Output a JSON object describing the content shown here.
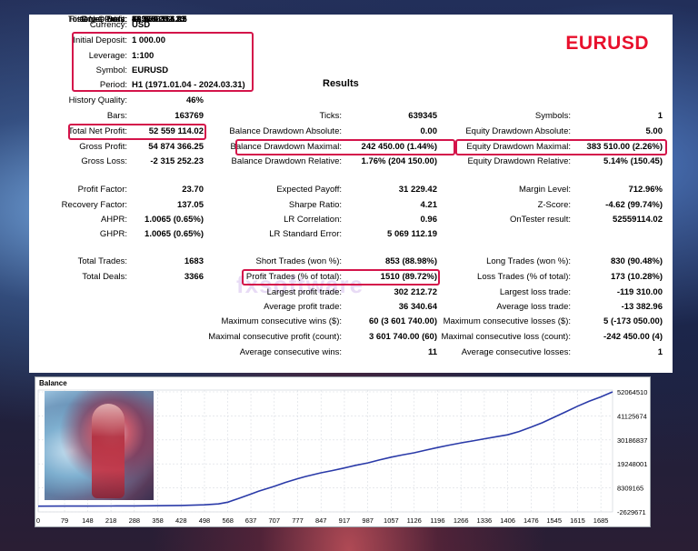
{
  "panel_title": "EURUSD",
  "results_title": "Results",
  "top_left": [
    {
      "label": "Currency:",
      "value": "USD"
    },
    {
      "label": "Initial Deposit:",
      "value": "1 000.00"
    },
    {
      "label": "Leverage:",
      "value": "1:100"
    },
    {
      "label": "Symbol:",
      "value": "EURUSD"
    },
    {
      "label": "Period:",
      "value": "H1 (1971.01.04 - 2024.03.31)"
    },
    {
      "label": "History Quality:",
      "value": "46%"
    },
    {
      "label": "Bars:",
      "value": "163769"
    },
    {
      "label": "Total Net Profit:",
      "value": "52 559 114.02"
    },
    {
      "label": "Gross Profit:",
      "value": "54 874 366.25"
    },
    {
      "label": "Gross Loss:",
      "value": "-2 315 252.23"
    }
  ],
  "mid_top": [
    {
      "label": "Ticks:",
      "value": "639345"
    },
    {
      "label": "Balance Drawdown Absolute:",
      "value": "0.00"
    },
    {
      "label": "Balance Drawdown Maximal:",
      "value": "242 450.00 (1.44%)"
    },
    {
      "label": "Balance Drawdown Relative:",
      "value": "1.76% (204 150.00)"
    }
  ],
  "right_top": [
    {
      "label": "Symbols:",
      "value": "1"
    },
    {
      "label": "Equity Drawdown Absolute:",
      "value": "5.00"
    },
    {
      "label": "Equity Drawdown Maximal:",
      "value": "383 510.00 (2.26%)"
    },
    {
      "label": "Equity Drawdown Relative:",
      "value": "5.14% (150.45)"
    }
  ],
  "left_mid": [
    {
      "label": "Profit Factor:",
      "value": "23.70"
    },
    {
      "label": "Recovery Factor:",
      "value": "137.05"
    },
    {
      "label": "AHPR:",
      "value": "1.0065 (0.65%)"
    },
    {
      "label": "GHPR:",
      "value": "1.0065 (0.65%)"
    }
  ],
  "mid_mid": [
    {
      "label": "Expected Payoff:",
      "value": "31 229.42"
    },
    {
      "label": "Sharpe Ratio:",
      "value": "4.21"
    },
    {
      "label": "LR Correlation:",
      "value": "0.96"
    },
    {
      "label": "LR Standard Error:",
      "value": "5 069 112.19"
    }
  ],
  "right_mid": [
    {
      "label": "Margin Level:",
      "value": "712.96%"
    },
    {
      "label": "Z-Score:",
      "value": "-4.62 (99.74%)"
    },
    {
      "label": "OnTester result:",
      "value": "52559114.02"
    }
  ],
  "left_bot": [
    {
      "label": "Total Trades:",
      "value": "1683"
    },
    {
      "label": "Total Deals:",
      "value": "3366"
    }
  ],
  "mid_bot": [
    {
      "label": "Short Trades (won %):",
      "value": "853 (88.98%)"
    },
    {
      "label": "Profit Trades (% of total):",
      "value": "1510 (89.72%)"
    },
    {
      "label": "Largest profit trade:",
      "value": "302 212.72"
    },
    {
      "label": "Average profit trade:",
      "value": "36 340.64"
    },
    {
      "label": "Maximum consecutive wins ($):",
      "value": "60 (3 601 740.00)"
    },
    {
      "label": "Maximal consecutive profit (count):",
      "value": "3 601 740.00 (60)"
    },
    {
      "label": "Average consecutive wins:",
      "value": "11"
    }
  ],
  "right_bot": [
    {
      "label": "Long Trades (won %):",
      "value": "830 (90.48%)"
    },
    {
      "label": "Loss Trades (% of total):",
      "value": "173 (10.28%)"
    },
    {
      "label": "Largest loss trade:",
      "value": "-119 310.00"
    },
    {
      "label": "Average loss trade:",
      "value": "-13 382.96"
    },
    {
      "label": "Maximum consecutive losses ($):",
      "value": "5 (-173 050.00)"
    },
    {
      "label": "Maximal consecutive loss (count):",
      "value": "-242 450.00 (4)"
    },
    {
      "label": "Average consecutive losses:",
      "value": "1"
    }
  ],
  "chart_data": {
    "type": "line",
    "title": "Balance",
    "x_ticks": [
      "0",
      "79",
      "148",
      "218",
      "288",
      "358",
      "428",
      "498",
      "568",
      "637",
      "707",
      "777",
      "847",
      "917",
      "987",
      "1057",
      "1126",
      "1196",
      "1266",
      "1336",
      "1406",
      "1476",
      "1545",
      "1615",
      "1685"
    ],
    "y_ticks": [
      "52064510",
      "41125674",
      "30186837",
      "19248001",
      "8309165",
      "-2629671"
    ],
    "ylim": [
      -2629671,
      52064510
    ],
    "xlim": [
      0,
      1720
    ],
    "series": [
      {
        "color": "#2a3aa8",
        "x": [
          0,
          79,
          148,
          218,
          288,
          358,
          428,
          498,
          540,
          568,
          600,
          637,
          660,
          707,
          740,
          777,
          800,
          847,
          880,
          917,
          950,
          987,
          1020,
          1057,
          1090,
          1126,
          1160,
          1196,
          1230,
          1266,
          1300,
          1336,
          1370,
          1406,
          1440,
          1476,
          1510,
          1545,
          1580,
          1615,
          1650,
          1685,
          1720
        ],
        "y": [
          1000,
          10000,
          30000,
          60000,
          100000,
          180000,
          300000,
          600000,
          1000000,
          1800000,
          3500000,
          5500000,
          6800000,
          9000000,
          10800000,
          12500000,
          13500000,
          15200000,
          16200000,
          17400000,
          18600000,
          19700000,
          21000000,
          22300000,
          23300000,
          24300000,
          25500000,
          26700000,
          27800000,
          28800000,
          29700000,
          30700000,
          31600000,
          32500000,
          34000000,
          36000000,
          38000000,
          40500000,
          43000000,
          45500000,
          47800000,
          49800000,
          52064510
        ]
      }
    ]
  }
}
